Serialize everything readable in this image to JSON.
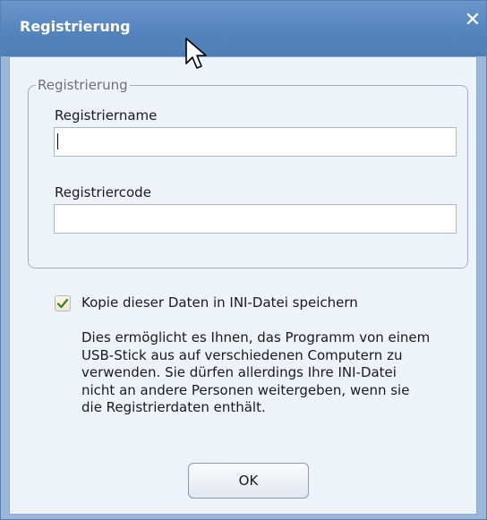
{
  "window": {
    "title": "Registrierung",
    "close_glyph": "✕"
  },
  "group": {
    "legend": "Registrierung",
    "name_label": "Registriername",
    "name_value": "",
    "code_label": "Registriercode",
    "code_value": ""
  },
  "options": {
    "save_ini_label": "Kopie dieser Daten in INI-Datei speichern",
    "save_ini_checked": true,
    "description": "Dies ermöglicht es Ihnen, das Programm von einem\nUSB-Stick aus auf verschiedenen Computern zu\nverwenden. Sie dürfen allerdings Ihre INI-Datei\nnicht an andere Personen weitergeben, wenn sie\ndie Registrierdaten enthält."
  },
  "buttons": {
    "ok_label": "OK"
  },
  "icons": {
    "close": "close-icon",
    "check": "checkmark-icon",
    "cursor": "mouse-pointer-icon"
  },
  "colors": {
    "titlebar": "#5584bd",
    "client_background": "#eef3fa",
    "checkmark": "#3b7a2a"
  }
}
